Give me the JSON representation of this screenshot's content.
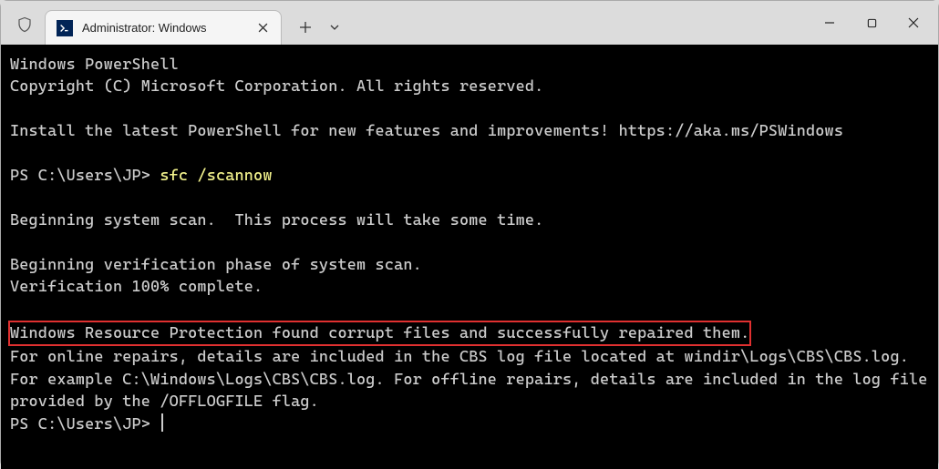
{
  "tab": {
    "title": "Administrator: Windows"
  },
  "terminal": {
    "line1": "Windows PowerShell",
    "line2": "Copyright (C) Microsoft Corporation. All rights reserved.",
    "line3": "Install the latest PowerShell for new features and improvements! https://aka.ms/PSWindows",
    "prompt1_prefix": "PS C:\\Users\\JP> ",
    "prompt1_cmd": "sfc /scannow",
    "line5": "Beginning system scan.  This process will take some time.",
    "line6": "Beginning verification phase of system scan.",
    "line7": "Verification 100% complete.",
    "highlight": "Windows Resource Protection found corrupt files and successfully repaired them.",
    "line9": "For online repairs, details are included in the CBS log file located at windir\\Logs\\CBS\\CBS.log. For example C:\\Windows\\Logs\\CBS\\CBS.log. For offline repairs, details are included in the log file provided by the /OFFLOGFILE flag.",
    "prompt2": "PS C:\\Users\\JP> "
  }
}
